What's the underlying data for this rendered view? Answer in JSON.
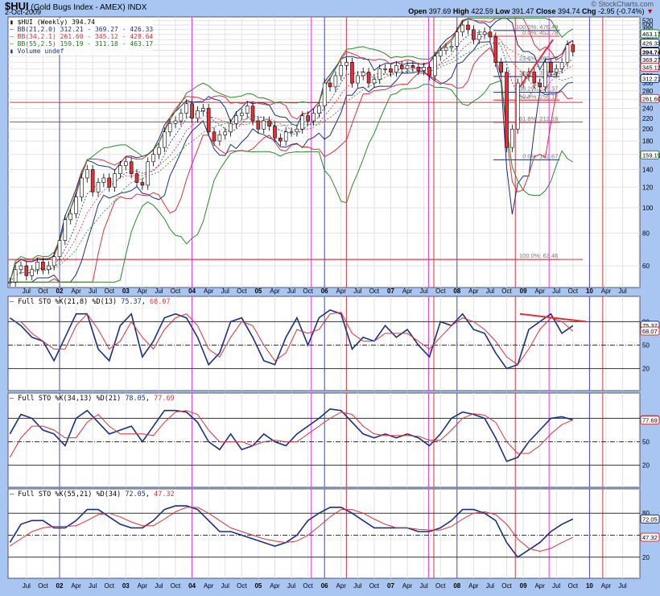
{
  "header": {
    "symbol": "$HUI",
    "name": "(Gold Bugs Index - AMEX)",
    "exchange": "INDX",
    "date": "2-Oct-2009",
    "brand": "© StockCharts.com",
    "open_label": "Open",
    "open": "397.69",
    "high_label": "High",
    "high": "422.59",
    "low_label": "Low",
    "low": "391.47",
    "close_label": "Close",
    "close": "394.74",
    "chg_label": "Chg",
    "chg": "-2.95 (-0.74%)",
    "chg_icon": "down-triangle-icon"
  },
  "legend": {
    "price": "$HUI (Weekly) 394.74",
    "bb1": "BB(21,2.0) 312.21 - 369.27 - 426.33",
    "bb2": "BB(34,2.1) 261.60 - 345.12 - 428.64",
    "bb3": "BB(55,2.5) 159.19 - 311.18 - 463.17",
    "volume": "Volume undef"
  },
  "panels": {
    "sto1": {
      "label": "Full STO %K(21,8) %D(13)",
      "k": "75.37",
      "d": "68.07"
    },
    "sto2": {
      "label": "Full STO %K(34,13) %D(21)",
      "k": "78.05",
      "d": "77.69"
    },
    "sto3": {
      "label": "Full STO %K(55,21) %D(34)",
      "k": "72.05",
      "d": "47.32"
    }
  },
  "colors": {
    "blue": "#1a2f86",
    "red": "#e0303a",
    "green": "#2a8a2a",
    "magenta": "#ee33ee",
    "marker_blue": "#4444ee",
    "bg": "#a9c6f2"
  },
  "chart_data": [
    {
      "type": "line",
      "title": "$HUI (Gold Bugs Index - AMEX) Weekly",
      "scale": "log",
      "ylim": [
        50,
        540
      ],
      "y_ticks": [
        60,
        80,
        100,
        120,
        140,
        160,
        180,
        200,
        220,
        240,
        260,
        280,
        300,
        320,
        340,
        360,
        380,
        400,
        420,
        440,
        460,
        480,
        500,
        520
      ],
      "x_start": "2001-04",
      "x_step": "month",
      "close": [
        52,
        58,
        60,
        55,
        58,
        62,
        58,
        60,
        65,
        75,
        90,
        95,
        110,
        130,
        140,
        115,
        125,
        130,
        120,
        135,
        145,
        150,
        135,
        125,
        122,
        150,
        160,
        170,
        195,
        210,
        215,
        230,
        250,
        220,
        235,
        240,
        195,
        180,
        190,
        195,
        210,
        225,
        230,
        245,
        215,
        200,
        215,
        205,
        185,
        180,
        195,
        195,
        200,
        225,
        215,
        230,
        245,
        300,
        290,
        320,
        350,
        360,
        300,
        320,
        330,
        300,
        310,
        340,
        340,
        330,
        350,
        340,
        350,
        345,
        335,
        345,
        320,
        380,
        400,
        410,
        415,
        470,
        500,
        480,
        440,
        460,
        470,
        450,
        360,
        330,
        170,
        200,
        300,
        320,
        330,
        300,
        290,
        360,
        330,
        340,
        360,
        420,
        395
      ],
      "price_tags": [
        {
          "value": "463.17",
          "color": "green"
        },
        {
          "value": "426.33",
          "color": "blue"
        },
        {
          "value": "394.74",
          "color": "black"
        },
        {
          "value": "369.27",
          "color": "blue"
        },
        {
          "value": "345.12",
          "color": "red"
        },
        {
          "value": "312.21",
          "color": "blue"
        },
        {
          "value": "261.60",
          "color": "red"
        },
        {
          "value": "159.19",
          "color": "green"
        }
      ],
      "horizontal_lines": [
        {
          "value": 253,
          "color": "red",
          "from": 2001.25,
          "to": 2009.9
        },
        {
          "value": 213,
          "color": "red",
          "from": 2001.25,
          "to": 2009.9
        },
        {
          "value": 63.46,
          "color": "red",
          "from": 2001.25,
          "to": 2009.9
        }
      ],
      "fib_levels": [
        {
          "label": "100.0%: 476.49",
          "value": 476.49,
          "color": "blue"
        },
        {
          "label": "0.0%: 452.78",
          "value": 452.78,
          "color": "red"
        },
        {
          "label": "23.6%: 360.70",
          "value": 360.7,
          "color": "blue"
        },
        {
          "label": "38.2%: 317.58",
          "value": 317.58,
          "color": "blue"
        },
        {
          "label": "38.2%: 276.37",
          "value": 276.37,
          "color": "blue"
        },
        {
          "label": "50.0%: 258.12",
          "value": 258.12,
          "color": "red"
        },
        {
          "label": "61.8%: 212.18",
          "value": 212.18,
          "color": "red"
        },
        {
          "label": "0.0%: 152.67",
          "value": 152.67,
          "color": "blue"
        },
        {
          "label": "100.0%: 63.46",
          "value": 63.46,
          "color": "red"
        }
      ],
      "trendlines": [
        {
          "from": [
            2008.95,
            290
          ],
          "to": [
            2009.45,
            440
          ],
          "color": "red"
        }
      ],
      "x_ticks": [
        "Jul",
        "Oct",
        "02",
        "Apr",
        "Jul",
        "Oct",
        "03",
        "Apr",
        "Jul",
        "Oct",
        "04",
        "Apr",
        "Jul",
        "Oct",
        "05",
        "Apr",
        "Jul",
        "Oct",
        "06",
        "Apr",
        "Jul",
        "Oct",
        "07",
        "Apr",
        "Jul",
        "Oct",
        "08",
        "Apr",
        "Jul",
        "Oct",
        "09",
        "Apr",
        "Jul",
        "Oct",
        "10",
        "Apr",
        "Jul"
      ],
      "markers": [
        {
          "at": 2002.0,
          "color": "marker_blue"
        },
        {
          "at": 2004.0,
          "color": "magenta"
        },
        {
          "at": 2005.8,
          "color": "magenta"
        },
        {
          "at": 2006.0,
          "color": "marker_blue"
        },
        {
          "at": 2006.33,
          "color": "red"
        },
        {
          "at": 2007.57,
          "color": "magenta"
        },
        {
          "at": 2007.65,
          "color": "red"
        },
        {
          "at": 2008.0,
          "color": "marker_blue"
        },
        {
          "at": 2008.88,
          "color": "red"
        },
        {
          "at": 2009.39,
          "color": "magenta"
        },
        {
          "at": 2010.0,
          "color": "marker_blue"
        },
        {
          "at": 2010.2,
          "color": "red"
        }
      ]
    },
    {
      "type": "line",
      "title": "Full STO %K(21,8) %D(13)",
      "ylim": [
        0,
        100
      ],
      "levels": [
        80,
        50,
        20
      ],
      "x_start": "2001-04",
      "x_step": "2 months",
      "series": [
        {
          "name": "%K",
          "color": "blue",
          "values": [
            85,
            75,
            60,
            55,
            30,
            60,
            90,
            90,
            45,
            30,
            75,
            90,
            35,
            55,
            85,
            90,
            85,
            60,
            25,
            40,
            80,
            85,
            60,
            30,
            25,
            60,
            85,
            50,
            85,
            95,
            90,
            45,
            60,
            55,
            75,
            60,
            70,
            50,
            35,
            80,
            75,
            90,
            70,
            65,
            40,
            20,
            25,
            70,
            80,
            90,
            65,
            75
          ]
        },
        {
          "name": "%D",
          "color": "red",
          "values": [
            80,
            80,
            65,
            55,
            45,
            45,
            75,
            90,
            70,
            45,
            55,
            80,
            60,
            45,
            70,
            85,
            90,
            75,
            45,
            35,
            60,
            80,
            75,
            50,
            30,
            40,
            70,
            65,
            70,
            90,
            92,
            65,
            55,
            55,
            65,
            65,
            65,
            55,
            45,
            60,
            75,
            85,
            80,
            70,
            55,
            35,
            25,
            45,
            70,
            85,
            80,
            68
          ]
        }
      ],
      "trendline": {
        "from": [
          2008.95,
          90
        ],
        "to": [
          2009.95,
          80
        ],
        "color": "red"
      }
    },
    {
      "type": "line",
      "title": "Full STO %K(34,13) %D(21)",
      "ylim": [
        0,
        100
      ],
      "levels": [
        80,
        50,
        20
      ],
      "x_start": "2001-04",
      "x_step": "2 months",
      "series": [
        {
          "name": "%K",
          "color": "blue",
          "values": [
            60,
            85,
            80,
            65,
            60,
            45,
            80,
            90,
            75,
            60,
            65,
            70,
            50,
            70,
            90,
            90,
            88,
            75,
            50,
            40,
            60,
            40,
            45,
            60,
            50,
            45,
            60,
            70,
            80,
            92,
            90,
            75,
            60,
            55,
            60,
            55,
            60,
            55,
            45,
            60,
            80,
            88,
            85,
            80,
            55,
            25,
            30,
            50,
            65,
            80,
            82,
            78
          ]
        },
        {
          "name": "%D",
          "color": "red",
          "values": [
            30,
            55,
            70,
            70,
            65,
            55,
            55,
            75,
            85,
            70,
            60,
            60,
            60,
            58,
            75,
            88,
            90,
            85,
            65,
            50,
            50,
            50,
            45,
            50,
            52,
            50,
            50,
            60,
            70,
            80,
            88,
            85,
            70,
            60,
            58,
            58,
            58,
            57,
            52,
            52,
            65,
            80,
            86,
            84,
            75,
            50,
            35,
            35,
            45,
            60,
            72,
            78
          ]
        }
      ]
    },
    {
      "type": "line",
      "title": "Full STO %K(55,21) %D(34)",
      "ylim": [
        0,
        100
      ],
      "levels": [
        80,
        50,
        20
      ],
      "x_start": "2001-04",
      "x_step": "2 months",
      "series": [
        {
          "name": "%K",
          "color": "blue",
          "values": [
            40,
            65,
            70,
            70,
            60,
            60,
            70,
            85,
            85,
            75,
            65,
            60,
            60,
            70,
            85,
            90,
            90,
            85,
            70,
            55,
            55,
            50,
            45,
            40,
            35,
            40,
            50,
            70,
            80,
            88,
            88,
            80,
            70,
            60,
            60,
            60,
            60,
            55,
            55,
            60,
            70,
            85,
            85,
            80,
            70,
            40,
            20,
            30,
            40,
            55,
            65,
            72
          ]
        },
        {
          "name": "%D",
          "color": "red",
          "values": [
            35,
            45,
            55,
            60,
            62,
            62,
            63,
            70,
            78,
            80,
            75,
            68,
            63,
            63,
            72,
            82,
            88,
            88,
            80,
            70,
            60,
            55,
            50,
            45,
            42,
            40,
            42,
            50,
            62,
            75,
            85,
            85,
            80,
            72,
            65,
            60,
            60,
            58,
            57,
            57,
            62,
            72,
            80,
            82,
            78,
            65,
            45,
            32,
            28,
            32,
            40,
            47
          ]
        }
      ]
    }
  ]
}
